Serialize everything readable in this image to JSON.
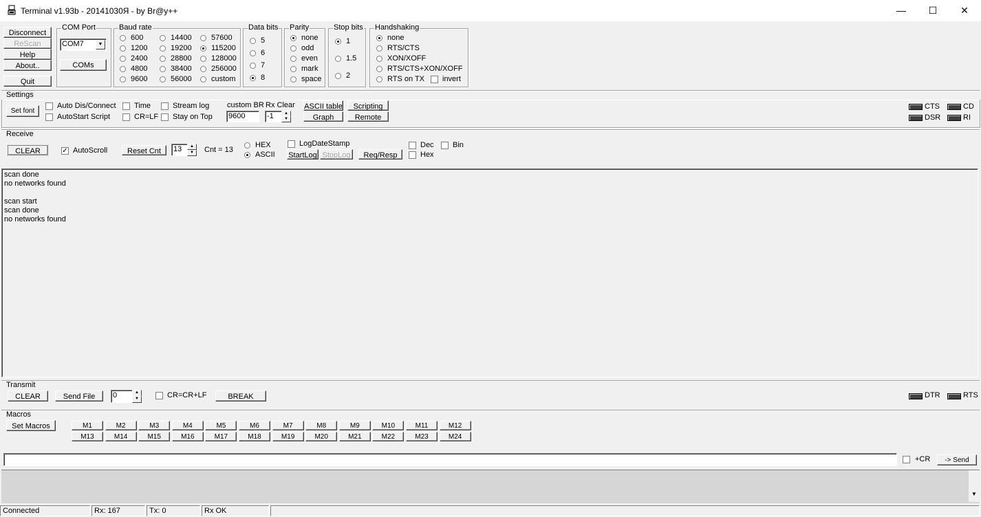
{
  "window": {
    "title": "Terminal v1.93b - 20141030Я - by Br@y++",
    "minimize": "—",
    "maximize": "☐",
    "close": "✕"
  },
  "main_buttons": {
    "disconnect": "Disconnect",
    "rescan": "ReScan",
    "help": "Help",
    "about": "About..",
    "quit": "Quit"
  },
  "com_port": {
    "label": "COM Port",
    "value": "COM7",
    "coms_button": "COMs"
  },
  "baud_rate": {
    "label": "Baud rate",
    "options": [
      "600",
      "1200",
      "2400",
      "4800",
      "9600",
      "14400",
      "19200",
      "28800",
      "38400",
      "56000",
      "57600",
      "115200",
      "128000",
      "256000",
      "custom"
    ],
    "selected": "115200"
  },
  "data_bits": {
    "label": "Data bits",
    "options": [
      "5",
      "6",
      "7",
      "8"
    ],
    "selected": "8"
  },
  "parity": {
    "label": "Parity",
    "options": [
      "none",
      "odd",
      "even",
      "mark",
      "space"
    ],
    "selected": "none"
  },
  "stop_bits": {
    "label": "Stop bits",
    "options": [
      "1",
      "1.5",
      "2"
    ],
    "selected": "1"
  },
  "handshaking": {
    "label": "Handshaking",
    "options": [
      "none",
      "RTS/CTS",
      "XON/XOFF",
      "RTS/CTS+XON/XOFF",
      "RTS on TX"
    ],
    "selected": "none",
    "invert": "invert"
  },
  "settings": {
    "label": "Settings",
    "set_font": "Set font",
    "auto_dis_connect": "Auto Dis/Connect",
    "autostart_script": "AutoStart Script",
    "time": "Time",
    "cr_lf": "CR=LF",
    "stream_log": "Stream log",
    "stay_on_top": "Stay on Top",
    "custom_br_label": "custom BR",
    "custom_br_value": "9600",
    "rx_clear_label": "Rx Clear",
    "rx_clear_value": "-1",
    "ascii_table": "ASCII table",
    "graph": "Graph",
    "scripting": "Scripting",
    "remote": "Remote",
    "cts": "CTS",
    "cd": "CD",
    "dsr": "DSR",
    "ri": "RI"
  },
  "receive": {
    "label": "Receive",
    "clear": "CLEAR",
    "autoscroll": "AutoScroll",
    "reset_cnt": "Reset Cnt",
    "cnt_spin": "13",
    "cnt_label": "Cnt =  13",
    "hex": "HEX",
    "ascii": "ASCII",
    "logdatestamp": "LogDateStamp",
    "startlog": "StartLog",
    "stoplog": "StopLog",
    "req_resp": "Req/Resp",
    "dec": "Dec",
    "bin": "Bin",
    "hex2": "Hex"
  },
  "receive_lines": [
    "scan done",
    "no networks found",
    "",
    "scan start",
    "scan done",
    "no networks found"
  ],
  "transmit": {
    "label": "Transmit",
    "clear": "CLEAR",
    "send_file": "Send File",
    "spin": "0",
    "cr_crlf": "CR=CR+LF",
    "break": "BREAK",
    "dtr": "DTR",
    "rts": "RTS"
  },
  "macros": {
    "label": "Macros",
    "set_macros": "Set Macros",
    "row1": [
      "M1",
      "M2",
      "M3",
      "M4",
      "M5",
      "M6",
      "M7",
      "M8",
      "M9",
      "M10",
      "M11",
      "M12"
    ],
    "row2": [
      "M13",
      "M14",
      "M15",
      "M16",
      "M17",
      "M18",
      "M19",
      "M20",
      "M21",
      "M22",
      "M23",
      "M24"
    ]
  },
  "send": {
    "input": "",
    "cr_label": "+CR",
    "send_button": "-> Send"
  },
  "status": {
    "connected": "Connected",
    "rx": "Rx: 167",
    "tx": "Tx: 0",
    "rx_ok": "Rx OK"
  }
}
